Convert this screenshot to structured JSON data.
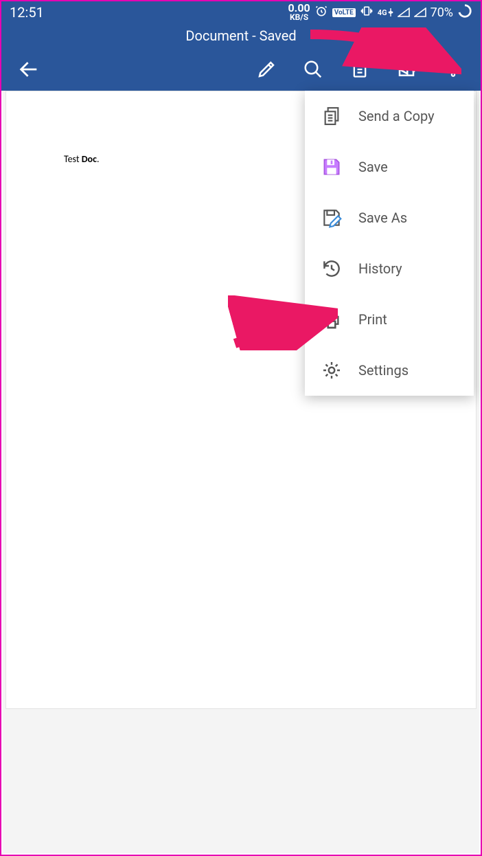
{
  "statusbar": {
    "time": "12:51",
    "data_rate": "0.00",
    "data_unit": "KB/S",
    "volte": "VoLTE",
    "network": "4G",
    "battery": "70%"
  },
  "titlebar": {
    "title": "Document - Saved"
  },
  "document": {
    "text_plain": "Test ",
    "text_bold": "Doc",
    "text_after": "."
  },
  "menu": {
    "items": [
      {
        "label": "Send a Copy",
        "icon": "send-copy"
      },
      {
        "label": "Save",
        "icon": "save"
      },
      {
        "label": "Save As",
        "icon": "save-as"
      },
      {
        "label": "History",
        "icon": "history"
      },
      {
        "label": "Print",
        "icon": "print"
      },
      {
        "label": "Settings",
        "icon": "settings"
      }
    ]
  },
  "colors": {
    "brand": "#2a569a",
    "accent_save": "#c77dff",
    "annotation": "#ea1864"
  }
}
